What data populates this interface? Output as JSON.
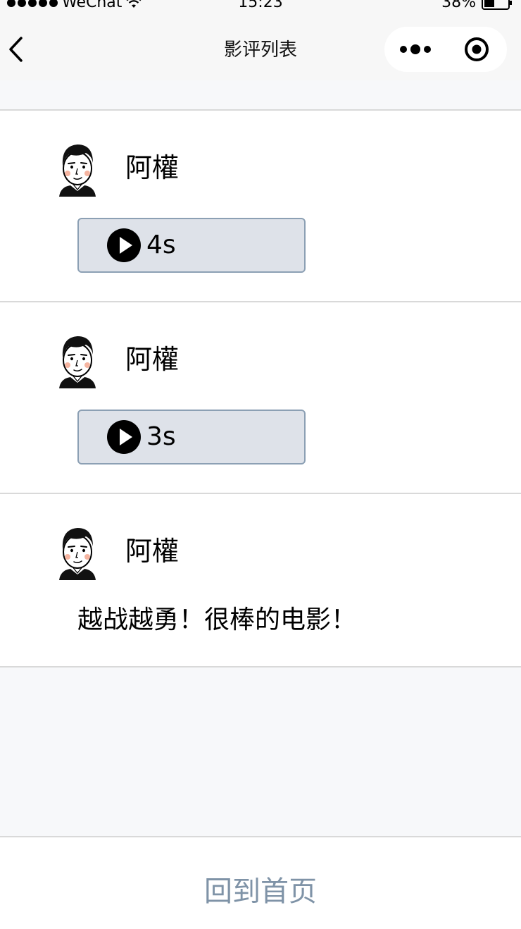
{
  "status_bar": {
    "carrier": "WeChat",
    "time": "15:23",
    "battery": "38%"
  },
  "nav": {
    "title": "影评列表"
  },
  "reviews": [
    {
      "user": "阿權",
      "type": "voice",
      "duration": "4s"
    },
    {
      "user": "阿權",
      "type": "voice",
      "duration": "3s"
    },
    {
      "user": "阿權",
      "type": "text",
      "text": "越战越勇！很棒的电影！"
    }
  ],
  "footer": {
    "home_label": "回到首页"
  },
  "colors": {
    "voice_bg": "#dee2e9",
    "voice_border": "#8ca0b4",
    "home_link": "#7f93a7"
  }
}
